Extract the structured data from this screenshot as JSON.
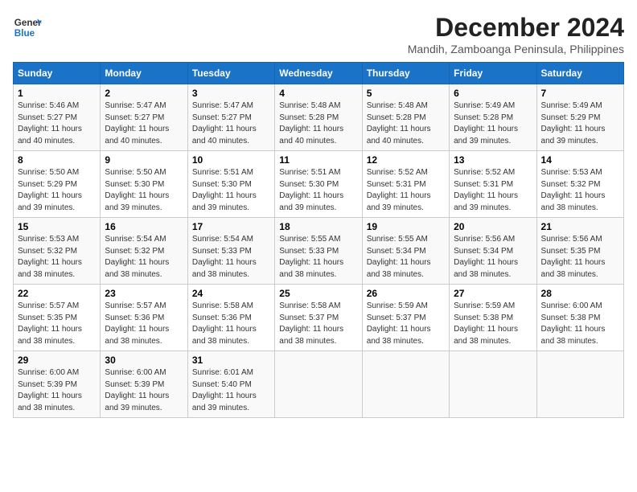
{
  "header": {
    "logo_line1": "General",
    "logo_line2": "Blue",
    "title": "December 2024",
    "subtitle": "Mandih, Zamboanga Peninsula, Philippines"
  },
  "columns": [
    "Sunday",
    "Monday",
    "Tuesday",
    "Wednesday",
    "Thursday",
    "Friday",
    "Saturday"
  ],
  "weeks": [
    [
      {
        "day": "1",
        "info": "Sunrise: 5:46 AM\nSunset: 5:27 PM\nDaylight: 11 hours\nand 40 minutes."
      },
      {
        "day": "2",
        "info": "Sunrise: 5:47 AM\nSunset: 5:27 PM\nDaylight: 11 hours\nand 40 minutes."
      },
      {
        "day": "3",
        "info": "Sunrise: 5:47 AM\nSunset: 5:27 PM\nDaylight: 11 hours\nand 40 minutes."
      },
      {
        "day": "4",
        "info": "Sunrise: 5:48 AM\nSunset: 5:28 PM\nDaylight: 11 hours\nand 40 minutes."
      },
      {
        "day": "5",
        "info": "Sunrise: 5:48 AM\nSunset: 5:28 PM\nDaylight: 11 hours\nand 40 minutes."
      },
      {
        "day": "6",
        "info": "Sunrise: 5:49 AM\nSunset: 5:28 PM\nDaylight: 11 hours\nand 39 minutes."
      },
      {
        "day": "7",
        "info": "Sunrise: 5:49 AM\nSunset: 5:29 PM\nDaylight: 11 hours\nand 39 minutes."
      }
    ],
    [
      {
        "day": "8",
        "info": "Sunrise: 5:50 AM\nSunset: 5:29 PM\nDaylight: 11 hours\nand 39 minutes."
      },
      {
        "day": "9",
        "info": "Sunrise: 5:50 AM\nSunset: 5:30 PM\nDaylight: 11 hours\nand 39 minutes."
      },
      {
        "day": "10",
        "info": "Sunrise: 5:51 AM\nSunset: 5:30 PM\nDaylight: 11 hours\nand 39 minutes."
      },
      {
        "day": "11",
        "info": "Sunrise: 5:51 AM\nSunset: 5:30 PM\nDaylight: 11 hours\nand 39 minutes."
      },
      {
        "day": "12",
        "info": "Sunrise: 5:52 AM\nSunset: 5:31 PM\nDaylight: 11 hours\nand 39 minutes."
      },
      {
        "day": "13",
        "info": "Sunrise: 5:52 AM\nSunset: 5:31 PM\nDaylight: 11 hours\nand 39 minutes."
      },
      {
        "day": "14",
        "info": "Sunrise: 5:53 AM\nSunset: 5:32 PM\nDaylight: 11 hours\nand 38 minutes."
      }
    ],
    [
      {
        "day": "15",
        "info": "Sunrise: 5:53 AM\nSunset: 5:32 PM\nDaylight: 11 hours\nand 38 minutes."
      },
      {
        "day": "16",
        "info": "Sunrise: 5:54 AM\nSunset: 5:32 PM\nDaylight: 11 hours\nand 38 minutes."
      },
      {
        "day": "17",
        "info": "Sunrise: 5:54 AM\nSunset: 5:33 PM\nDaylight: 11 hours\nand 38 minutes."
      },
      {
        "day": "18",
        "info": "Sunrise: 5:55 AM\nSunset: 5:33 PM\nDaylight: 11 hours\nand 38 minutes."
      },
      {
        "day": "19",
        "info": "Sunrise: 5:55 AM\nSunset: 5:34 PM\nDaylight: 11 hours\nand 38 minutes."
      },
      {
        "day": "20",
        "info": "Sunrise: 5:56 AM\nSunset: 5:34 PM\nDaylight: 11 hours\nand 38 minutes."
      },
      {
        "day": "21",
        "info": "Sunrise: 5:56 AM\nSunset: 5:35 PM\nDaylight: 11 hours\nand 38 minutes."
      }
    ],
    [
      {
        "day": "22",
        "info": "Sunrise: 5:57 AM\nSunset: 5:35 PM\nDaylight: 11 hours\nand 38 minutes."
      },
      {
        "day": "23",
        "info": "Sunrise: 5:57 AM\nSunset: 5:36 PM\nDaylight: 11 hours\nand 38 minutes."
      },
      {
        "day": "24",
        "info": "Sunrise: 5:58 AM\nSunset: 5:36 PM\nDaylight: 11 hours\nand 38 minutes."
      },
      {
        "day": "25",
        "info": "Sunrise: 5:58 AM\nSunset: 5:37 PM\nDaylight: 11 hours\nand 38 minutes."
      },
      {
        "day": "26",
        "info": "Sunrise: 5:59 AM\nSunset: 5:37 PM\nDaylight: 11 hours\nand 38 minutes."
      },
      {
        "day": "27",
        "info": "Sunrise: 5:59 AM\nSunset: 5:38 PM\nDaylight: 11 hours\nand 38 minutes."
      },
      {
        "day": "28",
        "info": "Sunrise: 6:00 AM\nSunset: 5:38 PM\nDaylight: 11 hours\nand 38 minutes."
      }
    ],
    [
      {
        "day": "29",
        "info": "Sunrise: 6:00 AM\nSunset: 5:39 PM\nDaylight: 11 hours\nand 38 minutes."
      },
      {
        "day": "30",
        "info": "Sunrise: 6:00 AM\nSunset: 5:39 PM\nDaylight: 11 hours\nand 39 minutes."
      },
      {
        "day": "31",
        "info": "Sunrise: 6:01 AM\nSunset: 5:40 PM\nDaylight: 11 hours\nand 39 minutes."
      },
      null,
      null,
      null,
      null
    ]
  ]
}
